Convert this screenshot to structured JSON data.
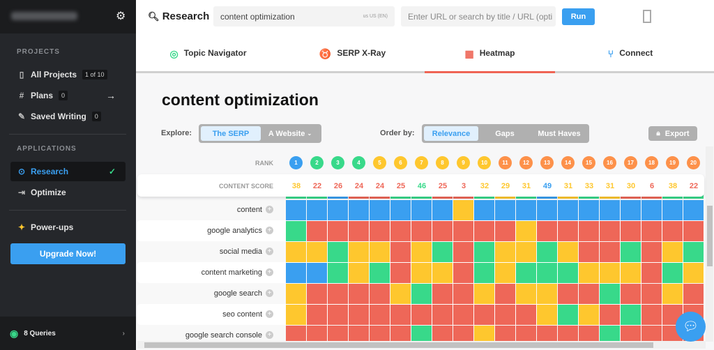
{
  "sidebar": {
    "projects_heading": "PROJECTS",
    "items": [
      {
        "label": "All Projects",
        "badge": "1 of 10"
      },
      {
        "label": "Plans",
        "badge": "0"
      },
      {
        "label": "Saved Writing",
        "badge": "0"
      }
    ],
    "applications_heading": "APPLICATIONS",
    "apps": [
      {
        "label": "Research",
        "active": true
      },
      {
        "label": "Optimize"
      }
    ],
    "powerups": "Power-ups",
    "upgrade": "Upgrade Now!",
    "queries": "8 Queries"
  },
  "header": {
    "title": "Research",
    "query": "content optimization",
    "locale_flag": "us",
    "locale": "US (EN)",
    "url_placeholder": "Enter URL or search by title / URL (opti",
    "run": "Run"
  },
  "tabs": [
    {
      "label": "Topic Navigator",
      "icon": "compass-icon"
    },
    {
      "label": "SERP X-Ray",
      "icon": "medal-icon"
    },
    {
      "label": "Heatmap",
      "icon": "grid-icon",
      "active": true
    },
    {
      "label": "Connect",
      "icon": "connect-icon"
    }
  ],
  "page_title": "content optimization",
  "explore": {
    "label": "Explore:",
    "options": [
      "The SERP",
      "A Website"
    ],
    "selected": "The SERP"
  },
  "order": {
    "label": "Order by:",
    "options": [
      "Relevance",
      "Gaps",
      "Must Haves"
    ],
    "selected": "Relevance"
  },
  "export": "Export",
  "heatmap": {
    "rank_label": "RANK",
    "score_label": "CONTENT SCORE",
    "ranks": [
      1,
      2,
      3,
      4,
      5,
      6,
      7,
      8,
      9,
      10,
      11,
      12,
      13,
      14,
      15,
      16,
      17,
      18,
      19,
      20
    ],
    "rank_colors": "BGGGYYYYYYOOOOOOOOOO",
    "scores": [
      38,
      22,
      26,
      24,
      24,
      25,
      46,
      25,
      3,
      32,
      29,
      31,
      49,
      31,
      33,
      31,
      30,
      6,
      38,
      22
    ],
    "score_colors": "YRRRRRGRRYYYBYYYYRYR",
    "colors": {
      "B": "#3a9ff0",
      "G": "#38d98a",
      "Y": "#fec72e",
      "R": "#ee6758",
      "O": "#fd914a"
    },
    "strip": "GGBRRGGRRGYGBYGYRRGG",
    "rows": [
      {
        "keyword": "content",
        "cells": "BBBBBBBBYBBBBBBBBBBB"
      },
      {
        "keyword": "google analytics",
        "cells": "GRRRRRRRRRRYRRRRRRRR"
      },
      {
        "keyword": "social media",
        "cells": "YYGYYRYGRGYYGYRRGRYG"
      },
      {
        "keyword": "content marketing",
        "cells": "BBGYGRYYRGYGGGYYYRGY"
      },
      {
        "keyword": "google search",
        "cells": "YRRRRYGRRYRYYRRGRRYR"
      },
      {
        "keyword": "seo content",
        "cells": "YRRRRRRRRRRRYGYRGRRR"
      },
      {
        "keyword": "google search console",
        "cells": "RRRRRRGRRYRRRRRGRRRR"
      }
    ]
  }
}
